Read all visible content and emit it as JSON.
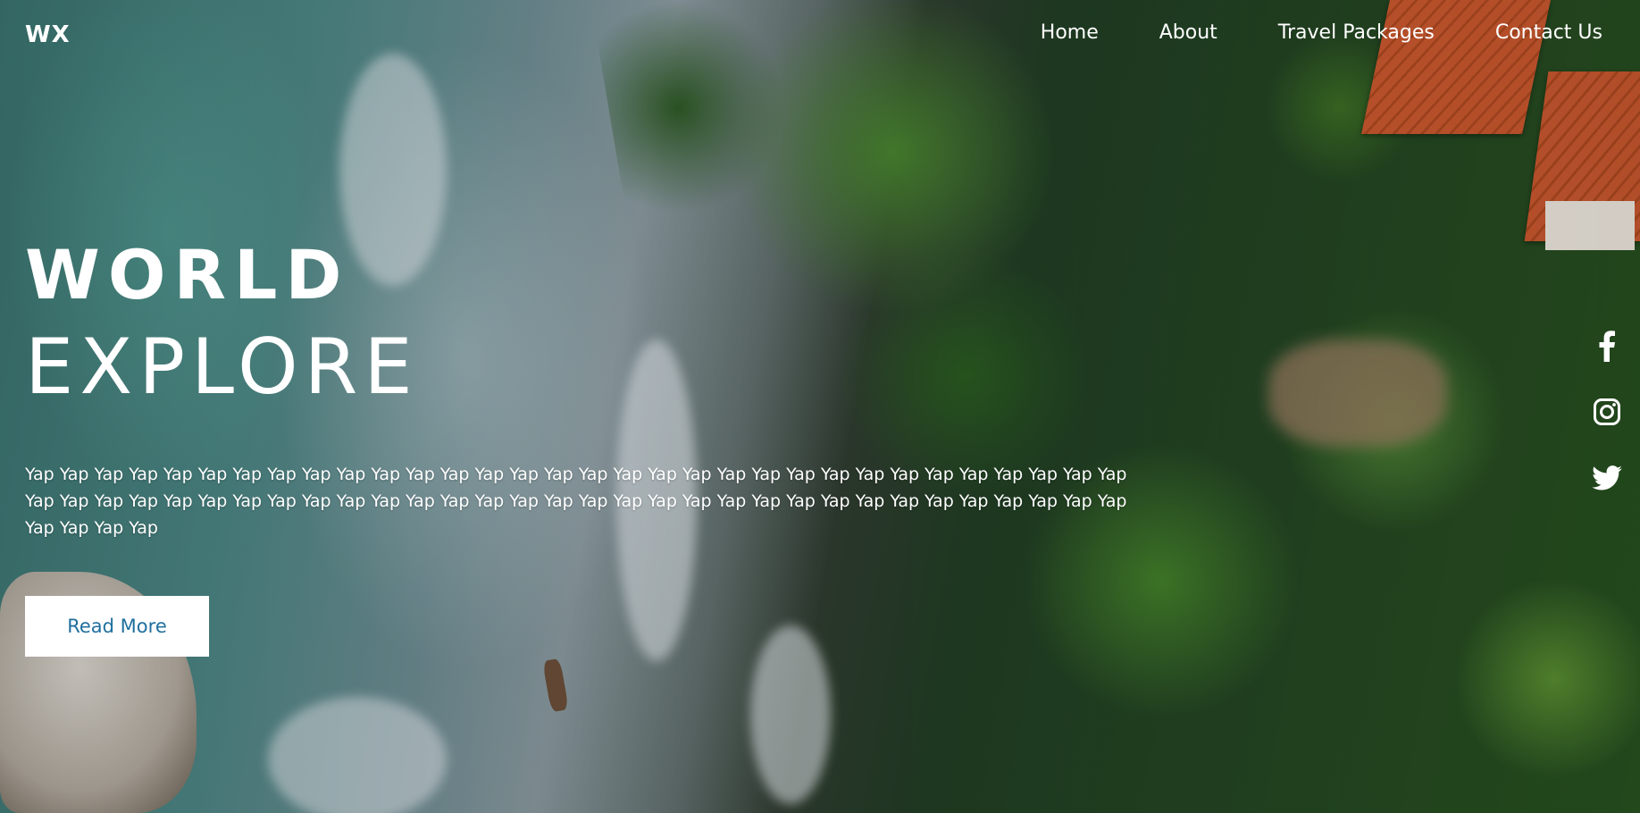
{
  "brand": {
    "logo": "WX"
  },
  "nav": {
    "items": [
      {
        "label": "Home"
      },
      {
        "label": "About"
      },
      {
        "label": "Travel Packages"
      },
      {
        "label": "Contact Us"
      }
    ]
  },
  "hero": {
    "title_line1": "WORLD",
    "title_line2": "EXPLORE",
    "description": "Yap Yap Yap Yap Yap Yap Yap Yap Yap Yap Yap Yap Yap Yap Yap Yap Yap Yap Yap Yap Yap Yap Yap Yap Yap Yap Yap Yap Yap Yap Yap Yap Yap Yap Yap Yap Yap Yap Yap Yap Yap Yap Yap Yap Yap Yap Yap Yap Yap Yap Yap Yap Yap Yap Yap Yap Yap Yap Yap Yap Yap Yap Yap Yap Yap Yap Yap Yap",
    "button_label": "Read More"
  },
  "social": {
    "icons": [
      "facebook-icon",
      "instagram-icon",
      "twitter-icon"
    ]
  },
  "colors": {
    "text": "#ffffff",
    "button_bg": "#ffffff",
    "button_text": "#1f6f9e"
  }
}
